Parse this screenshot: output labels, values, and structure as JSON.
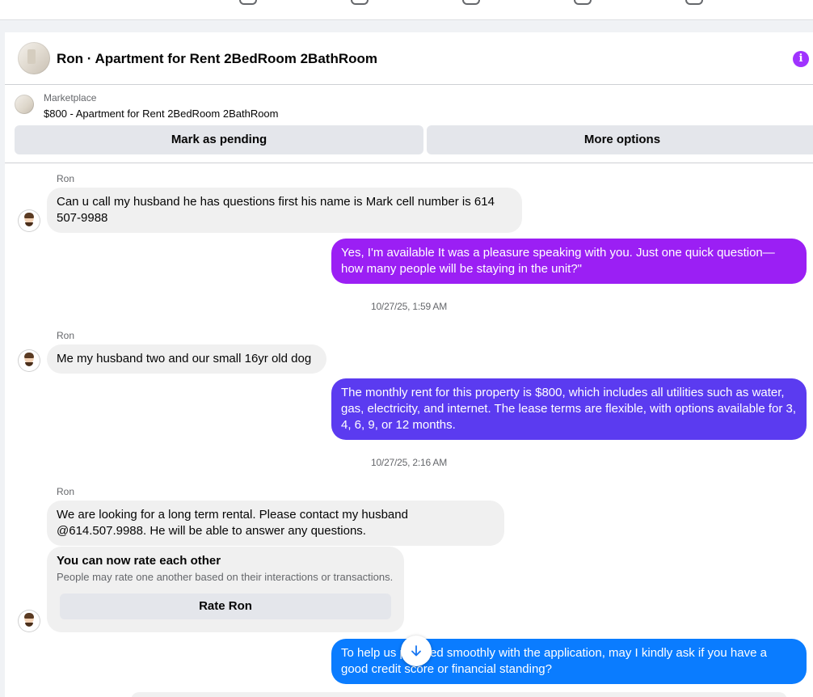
{
  "header": {
    "title": "Ron · Apartment for Rent 2BedRoom 2BathRoom",
    "info_icon": "info-icon"
  },
  "listing": {
    "label": "Marketplace",
    "description": "$800 - Apartment for Rent 2BedRoom 2BathRoom",
    "mark_pending_label": "Mark as pending",
    "more_options_label": "More options"
  },
  "colors": {
    "accent": "#a033ff",
    "outgoing_purple": "#9b1ff4",
    "outgoing_indigo": "#5b3bf0",
    "outgoing_blue": "#0a7cff",
    "incoming": "#f0f0f0"
  },
  "messages": [
    {
      "sender": "Ron",
      "text": "Can u call my husband  he has questions  first  his name  is  Mark  cell number is 614 507-9988"
    },
    {
      "text": "Yes, I'm available It was a pleasure speaking with you. Just one quick question—how many people will be staying in the unit?\""
    },
    {
      "timestamp": "10/27/25, 1:59 AM"
    },
    {
      "sender": "Ron",
      "text": "Me my husband  two and our small 16yr old dog"
    },
    {
      "text": "The monthly rent for this property is $800, which includes all utilities such as water, gas, electricity, and internet. The lease terms are flexible, with options available for 3, 4, 6, 9, or 12 months."
    },
    {
      "timestamp": "10/27/25, 2:16 AM"
    },
    {
      "sender": "Ron",
      "text": "We are looking for a long term rental. Please contact my husband @614.507.9988. He will be able to answer any questions."
    },
    {
      "text": "To help us proceed smoothly with the application, may I kindly ask if you have a good credit score or financial standing?"
    }
  ],
  "rating": {
    "title": "You can now rate each other",
    "subtitle": "People may rate one another based on their interactions or transactions.",
    "button_label": "Rate Ron"
  }
}
